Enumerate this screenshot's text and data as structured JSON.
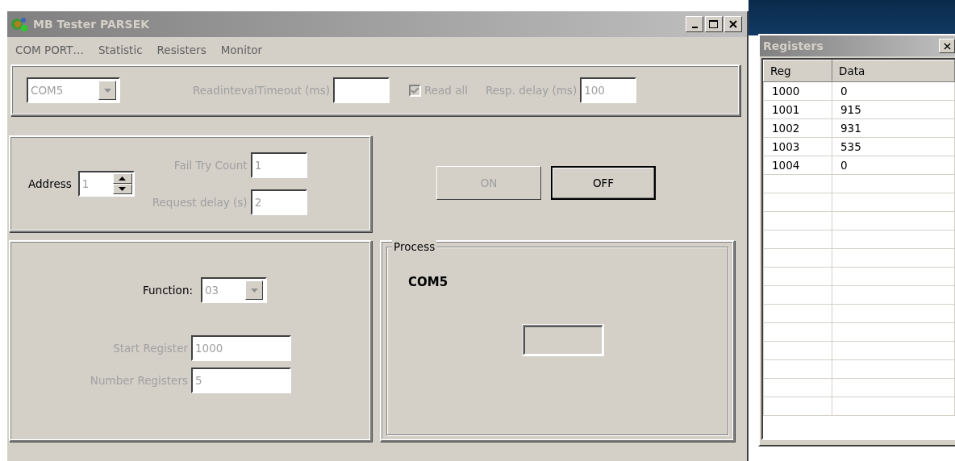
{
  "window": {
    "title": "MB Tester PARSEK"
  },
  "menu": [
    "COM PORT…",
    "Statistic",
    "Resisters",
    "Monitor"
  ],
  "port_panel": {
    "port": {
      "value": "COM5",
      "disabled": true
    },
    "read_interval_timeout": {
      "label": "ReadintevalTimeout (ms)",
      "disabled": true
    },
    "read_all": {
      "label": "Read all",
      "checked": true,
      "disabled": true
    },
    "resp_delay": {
      "label": "Resp. delay (ms)",
      "value": "100",
      "disabled": true
    }
  },
  "address_panel": {
    "address": {
      "label": "Address",
      "value": "1",
      "disabled": true
    },
    "fail_try_count": {
      "label": "Fail Try Count",
      "value": "1",
      "disabled": true
    },
    "request_delay": {
      "label": "Request delay (s)",
      "value": "2",
      "disabled": true
    }
  },
  "buttons": [
    {
      "label": "ON",
      "disabled": true
    },
    {
      "label": "OFF",
      "disabled": false
    }
  ],
  "function_panel": {
    "function": {
      "label": "Function:",
      "value": "03",
      "disabled": true
    },
    "start_register": {
      "label": "Start Register",
      "value": "1000",
      "disabled": true
    },
    "number_registers": {
      "label": "Number Registers",
      "value": "5",
      "disabled": true
    }
  },
  "process": {
    "title": "Process",
    "port": "COM5"
  },
  "registers": {
    "title": "Registers",
    "columns": [
      "Reg",
      "Data"
    ],
    "rows": [
      [
        "1000",
        "0"
      ],
      [
        "1001",
        "915"
      ],
      [
        "1002",
        "931"
      ],
      [
        "1003",
        "535"
      ],
      [
        "1004",
        "0"
      ]
    ]
  }
}
